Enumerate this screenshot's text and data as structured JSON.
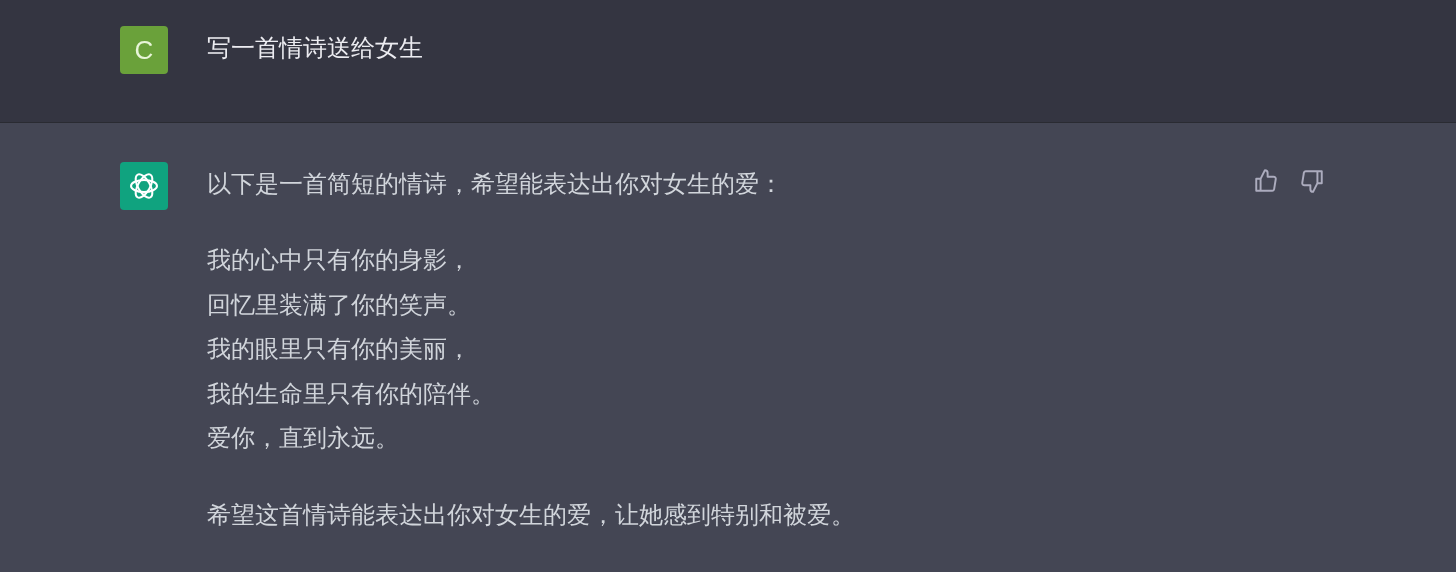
{
  "user_message": {
    "avatar_letter": "C",
    "text": "写一首情诗送给女生"
  },
  "assistant_message": {
    "blocks": [
      {
        "kind": "paragraph",
        "text": "以下是一首简短的情诗，希望能表达出你对女生的爱："
      },
      {
        "kind": "poem",
        "lines": [
          "我的心中只有你的身影，",
          "回忆里装满了你的笑声。",
          "我的眼里只有你的美丽，",
          "我的生命里只有你的陪伴。",
          "爱你，直到永远。"
        ]
      },
      {
        "kind": "paragraph",
        "text": "希望这首情诗能表达出你对女生的爱，让她感到特别和被爱。"
      }
    ]
  }
}
